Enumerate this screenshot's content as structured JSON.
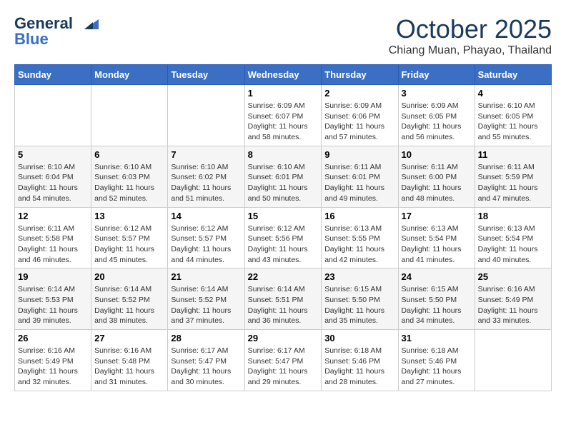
{
  "logo": {
    "line1": "General",
    "line2": "Blue"
  },
  "title": "October 2025",
  "location": "Chiang Muan, Phayao, Thailand",
  "weekdays": [
    "Sunday",
    "Monday",
    "Tuesday",
    "Wednesday",
    "Thursday",
    "Friday",
    "Saturday"
  ],
  "weeks": [
    [
      null,
      null,
      null,
      {
        "day": "1",
        "sunrise": "6:09 AM",
        "sunset": "6:07 PM",
        "daylight": "11 hours and 58 minutes."
      },
      {
        "day": "2",
        "sunrise": "6:09 AM",
        "sunset": "6:06 PM",
        "daylight": "11 hours and 57 minutes."
      },
      {
        "day": "3",
        "sunrise": "6:09 AM",
        "sunset": "6:05 PM",
        "daylight": "11 hours and 56 minutes."
      },
      {
        "day": "4",
        "sunrise": "6:10 AM",
        "sunset": "6:05 PM",
        "daylight": "11 hours and 55 minutes."
      }
    ],
    [
      {
        "day": "5",
        "sunrise": "6:10 AM",
        "sunset": "6:04 PM",
        "daylight": "11 hours and 54 minutes."
      },
      {
        "day": "6",
        "sunrise": "6:10 AM",
        "sunset": "6:03 PM",
        "daylight": "11 hours and 52 minutes."
      },
      {
        "day": "7",
        "sunrise": "6:10 AM",
        "sunset": "6:02 PM",
        "daylight": "11 hours and 51 minutes."
      },
      {
        "day": "8",
        "sunrise": "6:10 AM",
        "sunset": "6:01 PM",
        "daylight": "11 hours and 50 minutes."
      },
      {
        "day": "9",
        "sunrise": "6:11 AM",
        "sunset": "6:01 PM",
        "daylight": "11 hours and 49 minutes."
      },
      {
        "day": "10",
        "sunrise": "6:11 AM",
        "sunset": "6:00 PM",
        "daylight": "11 hours and 48 minutes."
      },
      {
        "day": "11",
        "sunrise": "6:11 AM",
        "sunset": "5:59 PM",
        "daylight": "11 hours and 47 minutes."
      }
    ],
    [
      {
        "day": "12",
        "sunrise": "6:11 AM",
        "sunset": "5:58 PM",
        "daylight": "11 hours and 46 minutes."
      },
      {
        "day": "13",
        "sunrise": "6:12 AM",
        "sunset": "5:57 PM",
        "daylight": "11 hours and 45 minutes."
      },
      {
        "day": "14",
        "sunrise": "6:12 AM",
        "sunset": "5:57 PM",
        "daylight": "11 hours and 44 minutes."
      },
      {
        "day": "15",
        "sunrise": "6:12 AM",
        "sunset": "5:56 PM",
        "daylight": "11 hours and 43 minutes."
      },
      {
        "day": "16",
        "sunrise": "6:13 AM",
        "sunset": "5:55 PM",
        "daylight": "11 hours and 42 minutes."
      },
      {
        "day": "17",
        "sunrise": "6:13 AM",
        "sunset": "5:54 PM",
        "daylight": "11 hours and 41 minutes."
      },
      {
        "day": "18",
        "sunrise": "6:13 AM",
        "sunset": "5:54 PM",
        "daylight": "11 hours and 40 minutes."
      }
    ],
    [
      {
        "day": "19",
        "sunrise": "6:14 AM",
        "sunset": "5:53 PM",
        "daylight": "11 hours and 39 minutes."
      },
      {
        "day": "20",
        "sunrise": "6:14 AM",
        "sunset": "5:52 PM",
        "daylight": "11 hours and 38 minutes."
      },
      {
        "day": "21",
        "sunrise": "6:14 AM",
        "sunset": "5:52 PM",
        "daylight": "11 hours and 37 minutes."
      },
      {
        "day": "22",
        "sunrise": "6:14 AM",
        "sunset": "5:51 PM",
        "daylight": "11 hours and 36 minutes."
      },
      {
        "day": "23",
        "sunrise": "6:15 AM",
        "sunset": "5:50 PM",
        "daylight": "11 hours and 35 minutes."
      },
      {
        "day": "24",
        "sunrise": "6:15 AM",
        "sunset": "5:50 PM",
        "daylight": "11 hours and 34 minutes."
      },
      {
        "day": "25",
        "sunrise": "6:16 AM",
        "sunset": "5:49 PM",
        "daylight": "11 hours and 33 minutes."
      }
    ],
    [
      {
        "day": "26",
        "sunrise": "6:16 AM",
        "sunset": "5:49 PM",
        "daylight": "11 hours and 32 minutes."
      },
      {
        "day": "27",
        "sunrise": "6:16 AM",
        "sunset": "5:48 PM",
        "daylight": "11 hours and 31 minutes."
      },
      {
        "day": "28",
        "sunrise": "6:17 AM",
        "sunset": "5:47 PM",
        "daylight": "11 hours and 30 minutes."
      },
      {
        "day": "29",
        "sunrise": "6:17 AM",
        "sunset": "5:47 PM",
        "daylight": "11 hours and 29 minutes."
      },
      {
        "day": "30",
        "sunrise": "6:18 AM",
        "sunset": "5:46 PM",
        "daylight": "11 hours and 28 minutes."
      },
      {
        "day": "31",
        "sunrise": "6:18 AM",
        "sunset": "5:46 PM",
        "daylight": "11 hours and 27 minutes."
      },
      null
    ]
  ]
}
